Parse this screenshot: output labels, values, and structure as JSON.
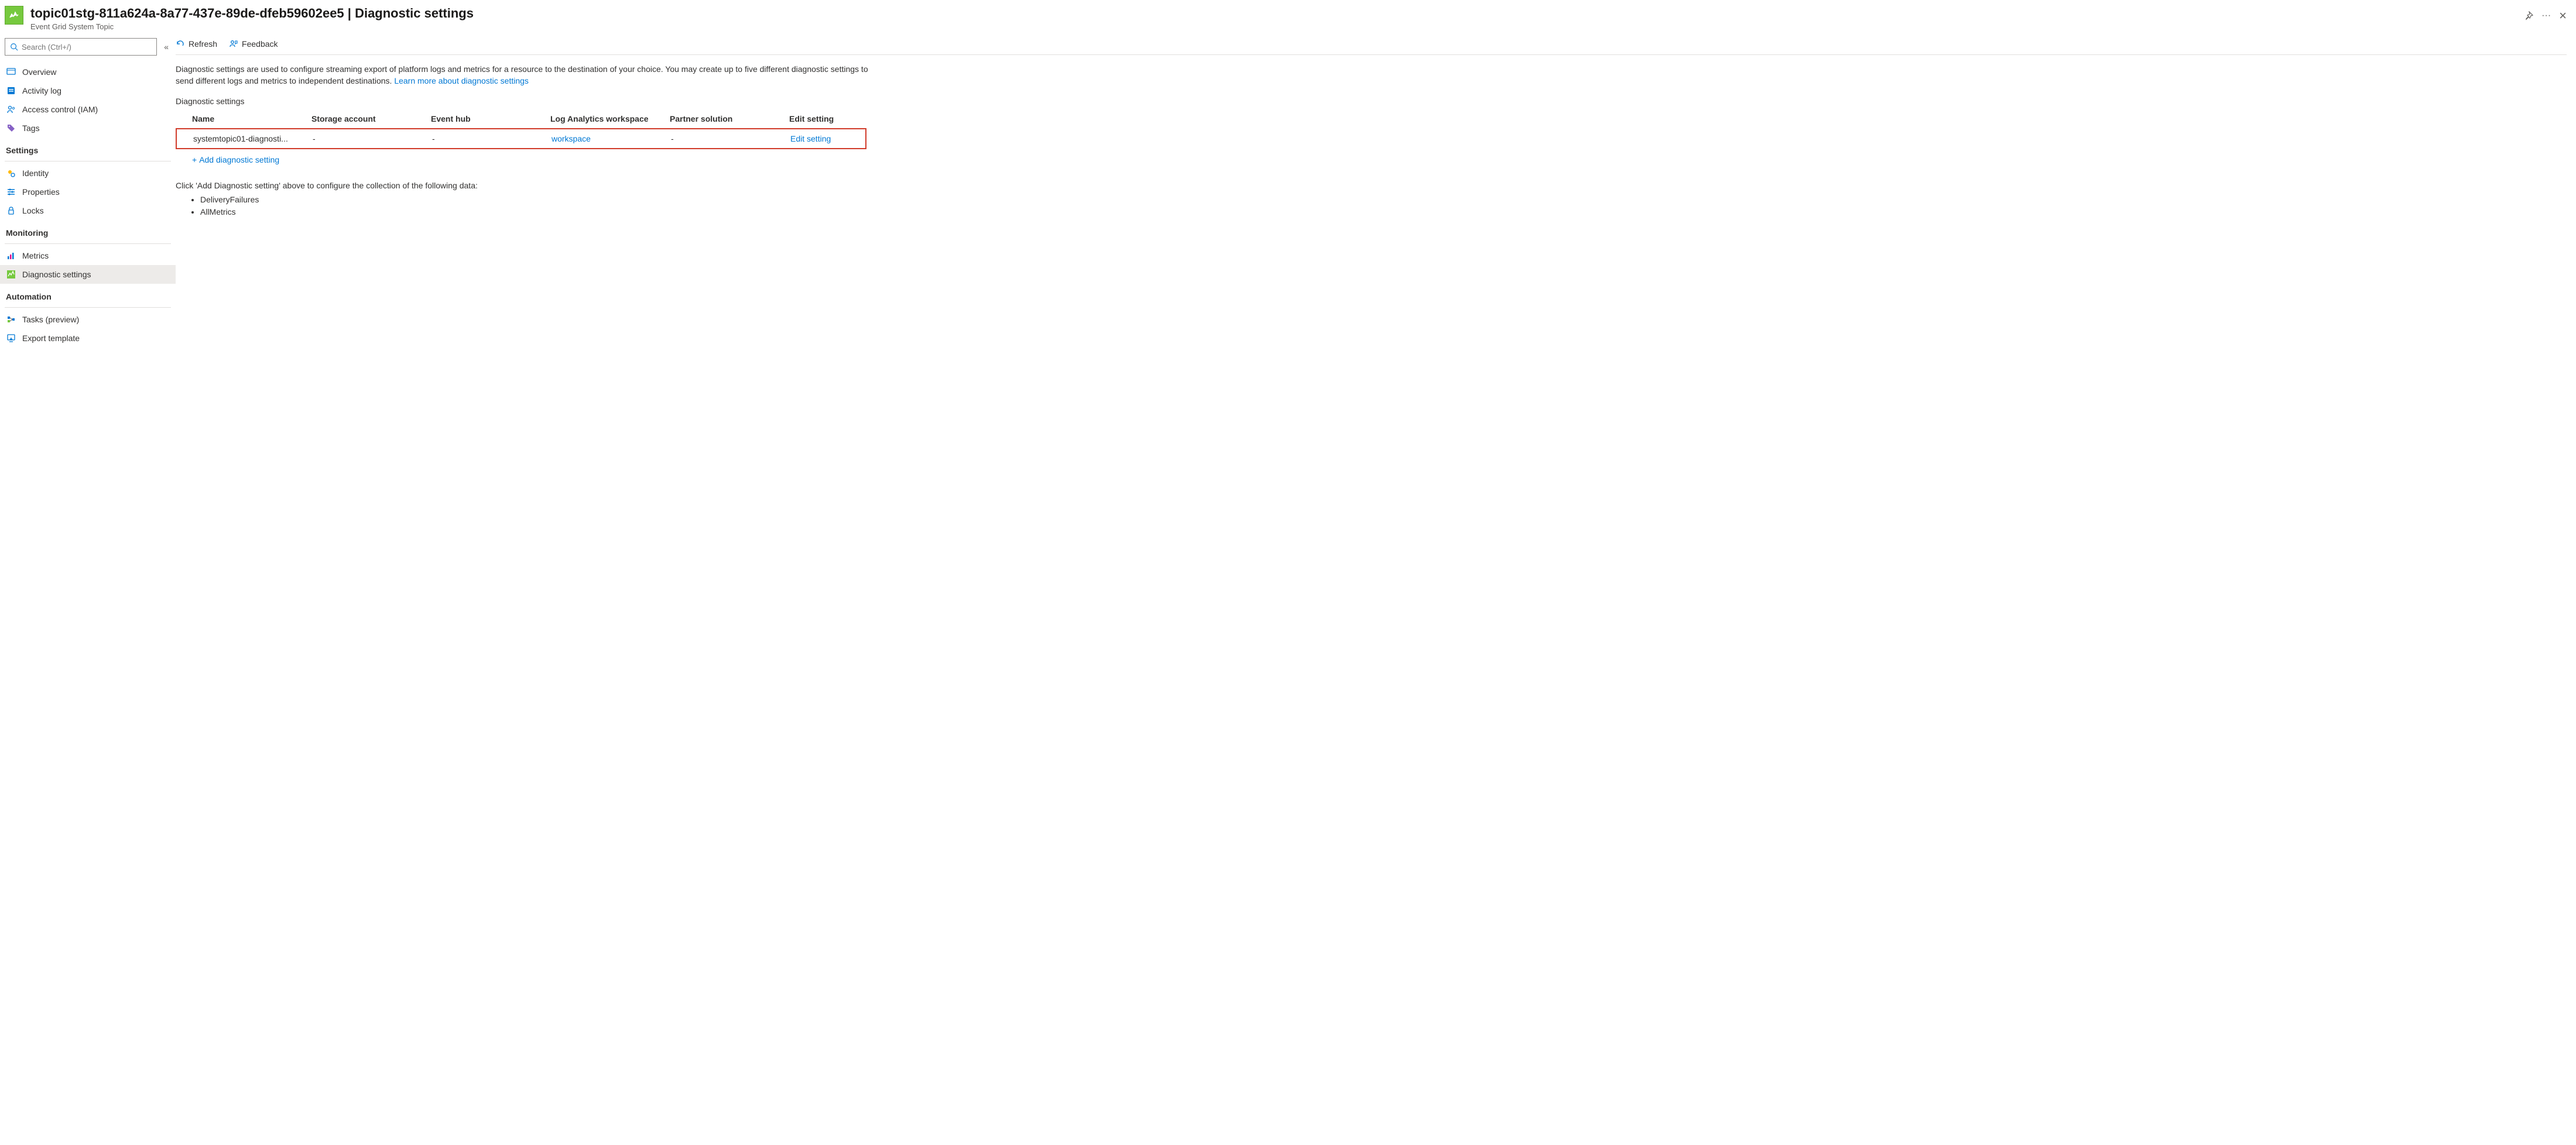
{
  "header": {
    "resource_name": "topic01stg-811a624a-8a77-437e-89de-dfeb59602ee5",
    "blade_title": "Diagnostic settings",
    "resource_type": "Event Grid System Topic"
  },
  "search": {
    "placeholder": "Search (Ctrl+/)"
  },
  "nav": {
    "top": [
      {
        "key": "overview",
        "label": "Overview"
      },
      {
        "key": "activity-log",
        "label": "Activity log"
      },
      {
        "key": "access-control",
        "label": "Access control (IAM)"
      },
      {
        "key": "tags",
        "label": "Tags"
      }
    ],
    "groups": [
      {
        "title": "Settings",
        "items": [
          {
            "key": "identity",
            "label": "Identity"
          },
          {
            "key": "properties",
            "label": "Properties"
          },
          {
            "key": "locks",
            "label": "Locks"
          }
        ]
      },
      {
        "title": "Monitoring",
        "items": [
          {
            "key": "metrics",
            "label": "Metrics"
          },
          {
            "key": "diagnostic-settings",
            "label": "Diagnostic settings",
            "selected": true
          }
        ]
      },
      {
        "title": "Automation",
        "items": [
          {
            "key": "tasks",
            "label": "Tasks (preview)"
          },
          {
            "key": "export-template",
            "label": "Export template"
          }
        ]
      }
    ]
  },
  "toolbar": {
    "refresh": "Refresh",
    "feedback": "Feedback"
  },
  "description": {
    "text": "Diagnostic settings are used to configure streaming export of platform logs and metrics for a resource to the destination of your choice. You may create up to five different diagnostic settings to send different logs and metrics to independent destinations. ",
    "link": "Learn more about diagnostic settings"
  },
  "table": {
    "section_label": "Diagnostic settings",
    "headers": {
      "name": "Name",
      "storage": "Storage account",
      "eventhub": "Event hub",
      "law": "Log Analytics workspace",
      "partner": "Partner solution",
      "edit": "Edit setting"
    },
    "rows": [
      {
        "name": "systemtopic01-diagnosti...",
        "storage": "-",
        "eventhub": "-",
        "law": "workspace",
        "partner": "-",
        "edit": "Edit setting"
      }
    ],
    "add_label": "Add diagnostic setting"
  },
  "hint": {
    "text": "Click 'Add Diagnostic setting' above to configure the collection of the following data:",
    "bullets": [
      "DeliveryFailures",
      "AllMetrics"
    ]
  }
}
